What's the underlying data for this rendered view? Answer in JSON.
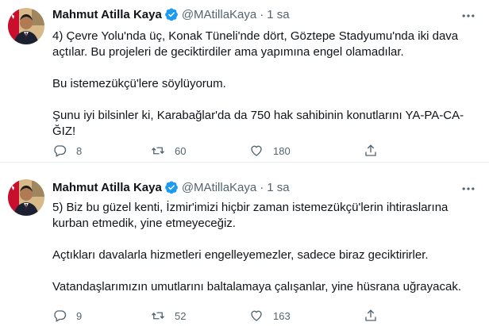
{
  "tweets": [
    {
      "author_name": "Mahmut Atilla Kaya",
      "handle": "@MAtillaKaya",
      "separator": "·",
      "time": "1 sa",
      "paragraphs": [
        "4) Çevre Yolu'nda üç, Konak Tüneli'nde dört, Göztepe Stadyumu'nda iki dava açtılar. Bu projeleri de geciktirdiler ama yapımına engel olamadılar.",
        "Bu istemezükçü'lere söylüyorum.",
        "Şunu iyi bilsinler ki, Karabağlar'da da 750 hak sahibinin konutlarını YA-PA-CA-ĞIZ!"
      ],
      "replies": "8",
      "retweets": "60",
      "likes": "180"
    },
    {
      "author_name": "Mahmut Atilla Kaya",
      "handle": "@MAtillaKaya",
      "separator": "·",
      "time": "1 sa",
      "paragraphs": [
        "5) Biz bu güzel kenti, İzmir'imizi hiçbir zaman istemezükçü'lerin ihtiraslarına kurban etmedik, yine etmeyeceğiz.",
        "Açtıkları davalarla hizmetleri engelleyemezler, sadece biraz geciktirirler.",
        "Vatandaşlarımızın umutlarını baltalamaya çalışanlar, yine hüsrana uğrayacak."
      ],
      "replies": "9",
      "retweets": "52",
      "likes": "163"
    }
  ],
  "icons": {
    "verified": "verified-badge-icon",
    "more": "more-options-icon",
    "reply": "reply-icon",
    "retweet": "retweet-icon",
    "like": "like-icon",
    "share": "share-icon"
  },
  "colors": {
    "text": "#0f1419",
    "secondary": "#536471",
    "verified": "#1d9bf0",
    "divider": "#e6ecf0"
  }
}
